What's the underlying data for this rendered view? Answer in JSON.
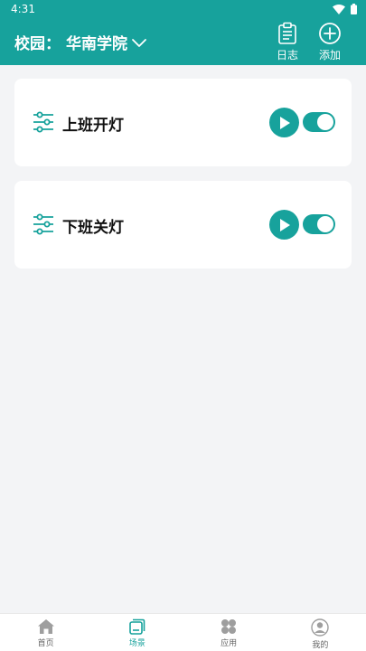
{
  "status_bar": {
    "time": "4:31"
  },
  "header": {
    "campus_label": "校园：",
    "campus_name": "华南学院",
    "log_label": "日志",
    "add_label": "添加"
  },
  "scenes": [
    {
      "name": "上班开灯",
      "enabled": true
    },
    {
      "name": "下班关灯",
      "enabled": true
    }
  ],
  "bottom_nav": {
    "items": [
      {
        "label": "首页",
        "icon": "home-icon",
        "active": false
      },
      {
        "label": "场景",
        "icon": "scene-icon",
        "active": true
      },
      {
        "label": "应用",
        "icon": "apps-icon",
        "active": false
      },
      {
        "label": "我的",
        "icon": "profile-icon",
        "active": false
      }
    ]
  },
  "colors": {
    "accent": "#17a29c",
    "background": "#f3f4f6",
    "inactive_nav": "#9e9e9e"
  }
}
